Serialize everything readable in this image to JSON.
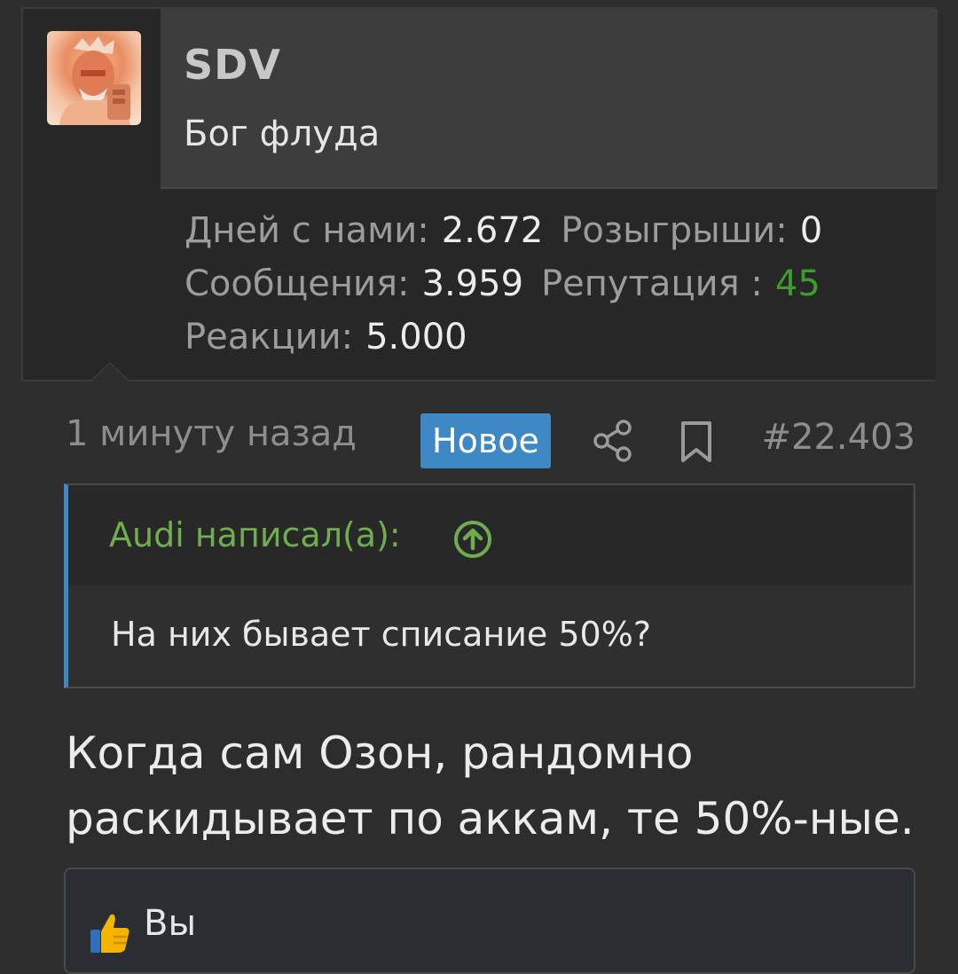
{
  "user": {
    "name": "SDV",
    "title": "Бог флуда",
    "stats": {
      "days_label": "Дней с нами:",
      "days_value": "2.672",
      "giveaways_label": "Розыгрыши:",
      "giveaways_value": "0",
      "messages_label": "Сообщения:",
      "messages_value": "3.959",
      "reputation_label": "Репутация :",
      "reputation_value": "45",
      "reactions_label": "Реакции:",
      "reactions_value": "5.000"
    }
  },
  "post": {
    "time": "1 минуту назад",
    "badge": "Новое",
    "number": "#22.403",
    "quote": {
      "author": "Audi написал(а):",
      "text": "На них бывает списание 50%?"
    },
    "body": "Когда сам Озон, рандомно раскидывает по аккам, те 50%-ные.",
    "reactions_text": "Вы"
  },
  "colors": {
    "badge": "#3f88c6",
    "reputation": "#3e9c2f",
    "quote_author": "#6fae4e",
    "quote_bar": "#3f88c6"
  },
  "icons": [
    "share-icon",
    "bookmark-icon",
    "arrow-up-circle-icon",
    "thumbs-up-icon"
  ]
}
